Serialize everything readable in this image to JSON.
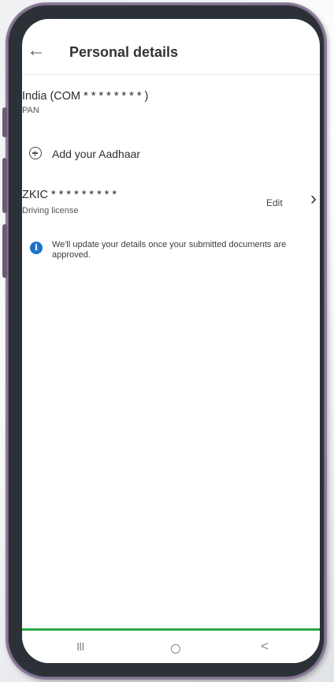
{
  "header": {
    "back_icon": "arrow-left-icon",
    "title": "Personal details"
  },
  "pan": {
    "value": "India (COM * * * * * * * * )",
    "type": "PAN"
  },
  "aadhaar": {
    "add_icon": "plus-circle-icon",
    "label": "Add your Aadhaar"
  },
  "driving_license": {
    "value": "ZKIC * * * * * * * * *",
    "type": "Driving license",
    "edit_label": "Edit",
    "chevron_icon": "chevron-right-icon"
  },
  "notice": {
    "icon": "info-icon",
    "text": "We'll update your details once your submitted documents are approved.",
    "icon_color": "#1a73c9"
  },
  "nav_bar": {
    "recent": "III",
    "home_icon": "home-circle-icon",
    "back": "<"
  },
  "colors": {
    "accent_green": "#2aa84a",
    "phone_frame": "#2c3137",
    "phone_rim": "#8a7a97"
  }
}
